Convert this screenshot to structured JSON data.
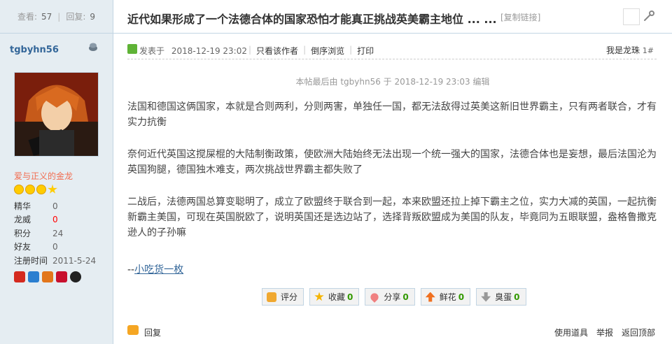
{
  "stats": {
    "views_label": "查看:",
    "views": "57",
    "replies_label": "回复:",
    "replies": "9"
  },
  "user": {
    "name": "tgbyhn56",
    "title": "爱与正义的金龙",
    "profile": [
      {
        "key": "精华",
        "value": "0"
      },
      {
        "key": "龙威",
        "value": "0"
      },
      {
        "key": "积分",
        "value": "24"
      },
      {
        "key": "好友",
        "value": "0"
      },
      {
        "key": "注册时间",
        "value": "2011-5-24"
      }
    ],
    "medal_icons": [
      "medal-1-icon",
      "medal-2-icon",
      "medal-3-icon",
      "medal-4-icon",
      "medal-5-icon"
    ]
  },
  "thread": {
    "title": "近代如果形成了一个法德合体的国家恐怕才能真正挑战英美霸主地位 ... ...",
    "copy_link": "[复制链接]"
  },
  "post": {
    "posted_prefix": "发表于",
    "posted_time": "2018-12-19 23:02",
    "only_author": "只看该作者",
    "reverse": "倒序浏览",
    "print": "打印",
    "floor_label": "我是龙珠",
    "floor_num": "1#",
    "edit_note": "本帖最后由 tgbyhn56 于 2018-12-19 23:03 编辑",
    "paragraphs": [
      "法国和德国这俩国家，本就是合则两利，分则两害，单独任一国，都无法敌得过英美这新旧世界霸主，只有两者联合，才有实力抗衡",
      "奈何近代英国这搅屎棍的大陆制衡政策，使欧洲大陆始终无法出现一个统一强大的国家，法德合体也是妄想，最后法国沦为英国狗腿，德国独木难支，两次挑战世界霸主都失败了",
      "二战后，法德两国总算变聪明了，成立了欧盟终于联合到一起，本来欧盟还拉上掉下霸主之位，实力大减的英国，一起抗衡新霸主美国，可现在英国脱欧了，说明英国还是选边站了，选择背叛欧盟成为美国的队友，毕竟同为五眼联盟，盎格鲁撒克逊人的子孙嘛"
    ],
    "signature_prefix": "--",
    "signature_link": "小吃货一枚"
  },
  "actions": [
    {
      "label": "评分",
      "count": ""
    },
    {
      "label": "收藏",
      "count": "0"
    },
    {
      "label": "分享",
      "count": "0"
    },
    {
      "label": "鲜花",
      "count": "0"
    },
    {
      "label": "臭蛋",
      "count": "0"
    }
  ],
  "footer": {
    "reply": "回复",
    "use_tool": "使用道具",
    "report": "举报",
    "back_top": "返回顶部"
  },
  "colors": {
    "link": "#336699",
    "accent": "#f26c4f",
    "sidebar_bg": "#e5edf2",
    "border": "#c2d5e3"
  }
}
